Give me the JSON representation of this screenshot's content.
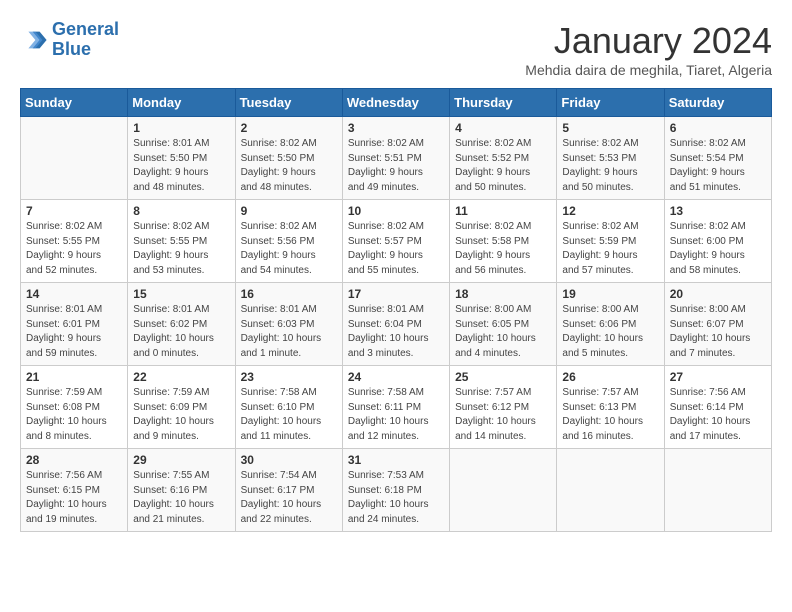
{
  "logo": {
    "line1": "General",
    "line2": "Blue"
  },
  "title": "January 2024",
  "location": "Mehdia daira de meghila, Tiaret, Algeria",
  "weekdays": [
    "Sunday",
    "Monday",
    "Tuesday",
    "Wednesday",
    "Thursday",
    "Friday",
    "Saturday"
  ],
  "weeks": [
    [
      {
        "day": "",
        "info": ""
      },
      {
        "day": "1",
        "info": "Sunrise: 8:01 AM\nSunset: 5:50 PM\nDaylight: 9 hours\nand 48 minutes."
      },
      {
        "day": "2",
        "info": "Sunrise: 8:02 AM\nSunset: 5:50 PM\nDaylight: 9 hours\nand 48 minutes."
      },
      {
        "day": "3",
        "info": "Sunrise: 8:02 AM\nSunset: 5:51 PM\nDaylight: 9 hours\nand 49 minutes."
      },
      {
        "day": "4",
        "info": "Sunrise: 8:02 AM\nSunset: 5:52 PM\nDaylight: 9 hours\nand 50 minutes."
      },
      {
        "day": "5",
        "info": "Sunrise: 8:02 AM\nSunset: 5:53 PM\nDaylight: 9 hours\nand 50 minutes."
      },
      {
        "day": "6",
        "info": "Sunrise: 8:02 AM\nSunset: 5:54 PM\nDaylight: 9 hours\nand 51 minutes."
      }
    ],
    [
      {
        "day": "7",
        "info": "Sunrise: 8:02 AM\nSunset: 5:55 PM\nDaylight: 9 hours\nand 52 minutes."
      },
      {
        "day": "8",
        "info": "Sunrise: 8:02 AM\nSunset: 5:55 PM\nDaylight: 9 hours\nand 53 minutes."
      },
      {
        "day": "9",
        "info": "Sunrise: 8:02 AM\nSunset: 5:56 PM\nDaylight: 9 hours\nand 54 minutes."
      },
      {
        "day": "10",
        "info": "Sunrise: 8:02 AM\nSunset: 5:57 PM\nDaylight: 9 hours\nand 55 minutes."
      },
      {
        "day": "11",
        "info": "Sunrise: 8:02 AM\nSunset: 5:58 PM\nDaylight: 9 hours\nand 56 minutes."
      },
      {
        "day": "12",
        "info": "Sunrise: 8:02 AM\nSunset: 5:59 PM\nDaylight: 9 hours\nand 57 minutes."
      },
      {
        "day": "13",
        "info": "Sunrise: 8:02 AM\nSunset: 6:00 PM\nDaylight: 9 hours\nand 58 minutes."
      }
    ],
    [
      {
        "day": "14",
        "info": "Sunrise: 8:01 AM\nSunset: 6:01 PM\nDaylight: 9 hours\nand 59 minutes."
      },
      {
        "day": "15",
        "info": "Sunrise: 8:01 AM\nSunset: 6:02 PM\nDaylight: 10 hours\nand 0 minutes."
      },
      {
        "day": "16",
        "info": "Sunrise: 8:01 AM\nSunset: 6:03 PM\nDaylight: 10 hours\nand 1 minute."
      },
      {
        "day": "17",
        "info": "Sunrise: 8:01 AM\nSunset: 6:04 PM\nDaylight: 10 hours\nand 3 minutes."
      },
      {
        "day": "18",
        "info": "Sunrise: 8:00 AM\nSunset: 6:05 PM\nDaylight: 10 hours\nand 4 minutes."
      },
      {
        "day": "19",
        "info": "Sunrise: 8:00 AM\nSunset: 6:06 PM\nDaylight: 10 hours\nand 5 minutes."
      },
      {
        "day": "20",
        "info": "Sunrise: 8:00 AM\nSunset: 6:07 PM\nDaylight: 10 hours\nand 7 minutes."
      }
    ],
    [
      {
        "day": "21",
        "info": "Sunrise: 7:59 AM\nSunset: 6:08 PM\nDaylight: 10 hours\nand 8 minutes."
      },
      {
        "day": "22",
        "info": "Sunrise: 7:59 AM\nSunset: 6:09 PM\nDaylight: 10 hours\nand 9 minutes."
      },
      {
        "day": "23",
        "info": "Sunrise: 7:58 AM\nSunset: 6:10 PM\nDaylight: 10 hours\nand 11 minutes."
      },
      {
        "day": "24",
        "info": "Sunrise: 7:58 AM\nSunset: 6:11 PM\nDaylight: 10 hours\nand 12 minutes."
      },
      {
        "day": "25",
        "info": "Sunrise: 7:57 AM\nSunset: 6:12 PM\nDaylight: 10 hours\nand 14 minutes."
      },
      {
        "day": "26",
        "info": "Sunrise: 7:57 AM\nSunset: 6:13 PM\nDaylight: 10 hours\nand 16 minutes."
      },
      {
        "day": "27",
        "info": "Sunrise: 7:56 AM\nSunset: 6:14 PM\nDaylight: 10 hours\nand 17 minutes."
      }
    ],
    [
      {
        "day": "28",
        "info": "Sunrise: 7:56 AM\nSunset: 6:15 PM\nDaylight: 10 hours\nand 19 minutes."
      },
      {
        "day": "29",
        "info": "Sunrise: 7:55 AM\nSunset: 6:16 PM\nDaylight: 10 hours\nand 21 minutes."
      },
      {
        "day": "30",
        "info": "Sunrise: 7:54 AM\nSunset: 6:17 PM\nDaylight: 10 hours\nand 22 minutes."
      },
      {
        "day": "31",
        "info": "Sunrise: 7:53 AM\nSunset: 6:18 PM\nDaylight: 10 hours\nand 24 minutes."
      },
      {
        "day": "",
        "info": ""
      },
      {
        "day": "",
        "info": ""
      },
      {
        "day": "",
        "info": ""
      }
    ]
  ]
}
